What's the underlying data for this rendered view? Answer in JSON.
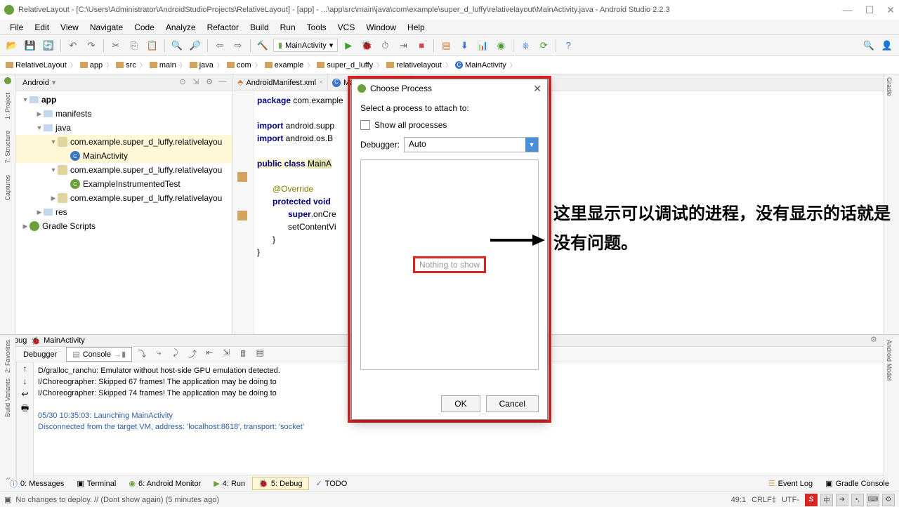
{
  "title": "RelativeLayout - [C:\\Users\\Administrator\\AndroidStudioProjects\\RelativeLayout] - [app] - ...\\app\\src\\main\\java\\com\\example\\super_d_luffy\\relativelayout\\MainActivity.java - Android Studio 2.2.3",
  "menu": [
    "File",
    "Edit",
    "View",
    "Navigate",
    "Code",
    "Analyze",
    "Refactor",
    "Build",
    "Run",
    "Tools",
    "VCS",
    "Window",
    "Help"
  ],
  "run_config": "MainActivity",
  "breadcrumb": [
    "RelativeLayout",
    "app",
    "src",
    "main",
    "java",
    "com",
    "example",
    "super_d_luffy",
    "relativelayout",
    "MainActivity"
  ],
  "project_header": "Android",
  "tree": {
    "app": "app",
    "manifests": "manifests",
    "java": "java",
    "pkg1": "com.example.super_d_luffy.relativelayou",
    "main_activity": "MainActivity",
    "pkg2": "com.example.super_d_luffy.relativelayou",
    "test": "ExampleInstrumentedTest",
    "pkg3": "com.example.super_d_luffy.relativelayou",
    "res": "res",
    "gradle": "Gradle Scripts"
  },
  "editor_tabs": {
    "t1": "AndroidManifest.xml",
    "t2": "MainActivity.java"
  },
  "code": {
    "l1a": "package",
    "l1b": " com.example",
    "l2a": "import",
    "l2b": " android.supp",
    "l3a": "import",
    "l3b": " android.os.B",
    "l4a": "public class ",
    "l4b": "MainA",
    "l5": "@Override",
    "l6a": "protected void",
    "l6b": "",
    "l7a": "super",
    "l7b": ".onCre",
    "l8": "setContentVi"
  },
  "dialog": {
    "title": "Choose Process",
    "subtitle": "Select a process to attach to:",
    "show_all": "Show all processes",
    "debugger_label": "Debugger:",
    "debugger_value": "Auto",
    "nothing": "Nothing to show",
    "ok": "OK",
    "cancel": "Cancel"
  },
  "annotation": "这里显示可以调试的进程，没有显示的话就是没有问题。",
  "debug": {
    "title": "Debug",
    "config": "MainActivity",
    "tab_debugger": "Debugger",
    "tab_console": "Console",
    "log1": "D/gralloc_ranchu: Emulator without host-side GPU emulation detected.",
    "log2": "I/Choreographer: Skipped 67 frames!  The application may be doing to",
    "log3": "I/Choreographer: Skipped 74 frames!  The application may be doing to",
    "log4": "05/30 10:35:03: Launching MainActivity",
    "log5": "Disconnected from the target VM, address: 'localhost:8618', transport: 'socket'"
  },
  "bottom_tabs": {
    "messages": "0: Messages",
    "terminal": "Terminal",
    "monitor": "6: Android Monitor",
    "run": "4: Run",
    "debug": "5: Debug",
    "todo": "TODO",
    "eventlog": "Event Log",
    "gradle": "Gradle Console"
  },
  "status": {
    "msg": "No changes to deploy. // (Dont show again) (5 minutes ago)",
    "pos": "49:1",
    "crlf": "CRLF‡",
    "enc": "UTF-"
  },
  "ime": {
    "s": "S",
    "ch": "中",
    "ban": "➔",
    "punct": "•,",
    "kb": "⌨",
    "cfg": "⚙"
  }
}
